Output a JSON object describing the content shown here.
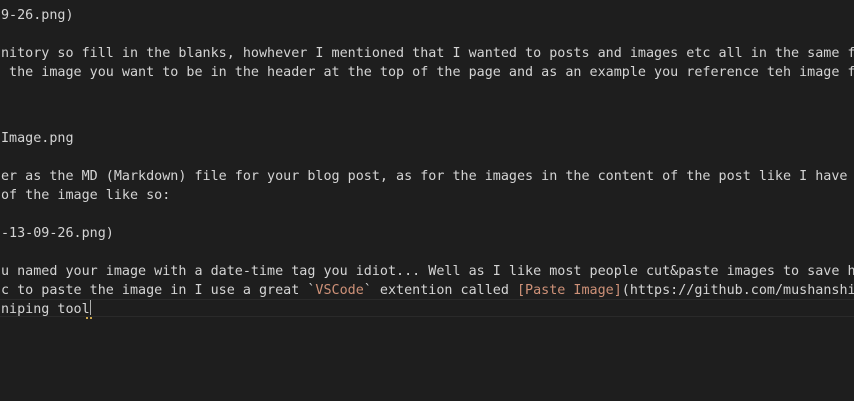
{
  "editor": {
    "lines": [
      "9-26.png)",
      "",
      "nitory so fill in the blanks, howhever I mentioned that I wanted to posts and images etc all in the same folder",
      " the image you want to be in the header at the top of the page and as an example you reference teh image from t",
      "",
      "",
      "Image.png",
      "",
      "er as the MD (Markdown) file for your blog post, as for the images in the content of the post like I have used",
      "of the image like so:",
      "",
      "-13-09-26.png)",
      "",
      "u named your image with a date-time tag you idiot... Well as I like most people cut&paste images to save having"
    ],
    "line15": {
      "prefix": "c to paste the image in I use a great `",
      "code": "VSCode",
      "mid": "` extention called ",
      "link_text": "[Paste Image]",
      "link_url": "(https://github.com/mushanshitianc"
    },
    "line16": "niping tool"
  },
  "colors": {
    "background": "#1e1e1e",
    "text": "#d4d4d4",
    "string": "#ce9178"
  }
}
